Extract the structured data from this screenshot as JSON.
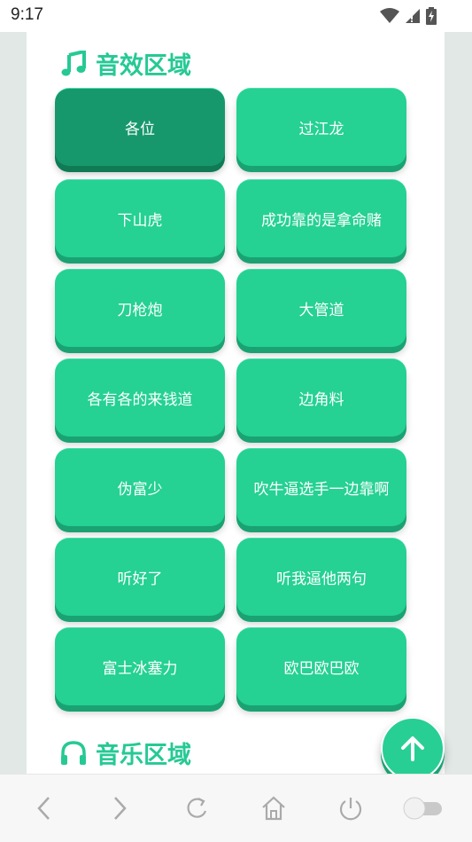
{
  "status_bar": {
    "time": "9:17"
  },
  "sections": {
    "sound_effects": {
      "title": "音效区域"
    },
    "music": {
      "title": "音乐区域"
    }
  },
  "buttons": [
    "各位",
    "过江龙",
    "下山虎",
    "成功靠的是拿命赌",
    "刀枪炮",
    "大管道",
    "各有各的来钱道",
    "边角料",
    "伪富少",
    "吹牛逼选手一边靠啊",
    "听好了",
    "听我逼他两句",
    "富士冰塞力",
    "欧巴欧巴欧"
  ],
  "active_button_index": 0,
  "colors": {
    "accent": "#26c994",
    "button": "#25d193",
    "button_active": "#17986c",
    "page_background": "#e1e8e5"
  },
  "icons": {
    "section_sound": "music-note-icon",
    "section_music": "headphones-icon",
    "fab": "arrow-up-icon",
    "nav": [
      "back-icon",
      "forward-icon",
      "refresh-icon",
      "home-icon",
      "power-icon",
      "toggle-switch"
    ]
  },
  "nav_toggle_on": false
}
